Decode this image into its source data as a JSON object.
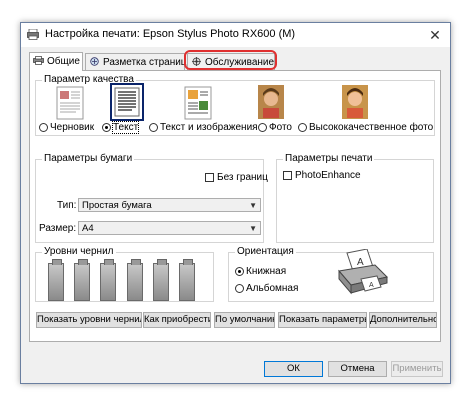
{
  "window": {
    "title": "Настройка печати: Epson Stylus Photo RX600 (M)",
    "close_glyph": "✕"
  },
  "tabs": [
    {
      "label": "Общие",
      "active": true
    },
    {
      "label": "Разметка страницы",
      "active": false
    },
    {
      "label": "Обслуживание",
      "active": false
    }
  ],
  "highlight_color": "#e03030",
  "quality": {
    "label": "Параметр качества",
    "options": [
      {
        "label": "Черновик",
        "selected": false
      },
      {
        "label": "Текст",
        "selected": true
      },
      {
        "label": "Текст и изображения",
        "selected": false
      },
      {
        "label": "Фото",
        "selected": false
      },
      {
        "label": "Высококачественное фото",
        "selected": false
      }
    ]
  },
  "paper": {
    "label": "Параметры бумаги",
    "borderless_label": "Без границ",
    "borderless_checked": false,
    "type_label": "Тип:",
    "type_value": "Простая бумага",
    "size_label": "Размер:",
    "size_value": "A4"
  },
  "print_options": {
    "label": "Параметры печати",
    "photo_enhance_label": "PhotoEnhance",
    "photo_enhance_checked": false
  },
  "ink_levels": {
    "label": "Уровни чернил",
    "count": 6
  },
  "orientation": {
    "label": "Ориентация",
    "options": [
      {
        "label": "Книжная",
        "selected": true
      },
      {
        "label": "Альбомная",
        "selected": false
      }
    ]
  },
  "buttons": {
    "show_ink": "Показать уровни чернил",
    "how_buy": "Как приобрести",
    "defaults": "По умолчанию",
    "show_settings": "Показать параметры",
    "advanced": "Дополнительно"
  },
  "footer": {
    "ok": "ОК",
    "cancel": "Отмена",
    "apply": "Применить"
  }
}
